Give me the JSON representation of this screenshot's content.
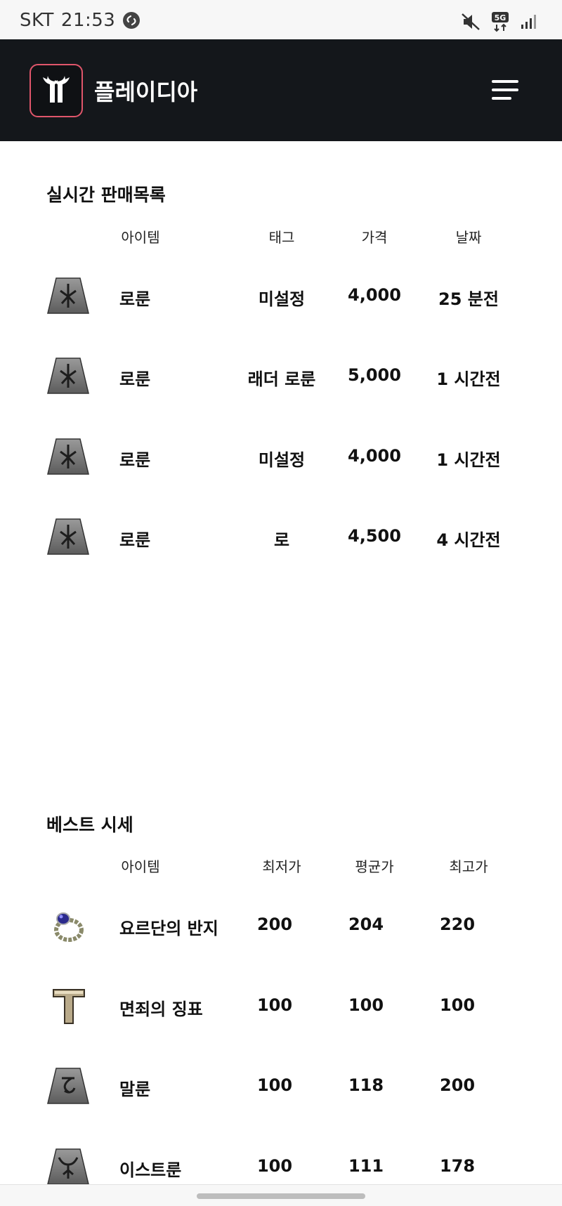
{
  "status_bar": {
    "carrier": "SKT",
    "time": "21:53",
    "network": "5G"
  },
  "header": {
    "brand": "플레이디아"
  },
  "live_sales": {
    "title": "실시간 판매목록",
    "columns": [
      "아이템",
      "태그",
      "가격",
      "날짜"
    ],
    "rows": [
      {
        "item": "로룬",
        "tag": "미설정",
        "price": "4,000",
        "date": "25 분전",
        "icon": "lo-rune-icon"
      },
      {
        "item": "로룬",
        "tag": "래더 로룬",
        "price": "5,000",
        "date": "1 시간전",
        "icon": "lo-rune-icon"
      },
      {
        "item": "로룬",
        "tag": "미설정",
        "price": "4,000",
        "date": "1 시간전",
        "icon": "lo-rune-icon"
      },
      {
        "item": "로룬",
        "tag": "로",
        "price": "4,500",
        "date": "4 시간전",
        "icon": "lo-rune-icon"
      }
    ]
  },
  "best_prices": {
    "title": "베스트 시세",
    "columns": [
      "아이템",
      "최저가",
      "평균가",
      "최고가"
    ],
    "rows": [
      {
        "item": "요르단의 반지",
        "min": "200",
        "avg": "204",
        "max": "220",
        "icon": "ring-icon"
      },
      {
        "item": "면죄의 징표",
        "min": "100",
        "avg": "100",
        "max": "100",
        "icon": "token-icon"
      },
      {
        "item": "말룬",
        "min": "100",
        "avg": "118",
        "max": "200",
        "icon": "mal-rune-icon"
      },
      {
        "item": "이스트룬",
        "min": "100",
        "avg": "111",
        "max": "178",
        "icon": "ist-rune-icon"
      }
    ]
  },
  "colors": {
    "header_bg": "#14171b",
    "logo_border": "#e0566b"
  }
}
